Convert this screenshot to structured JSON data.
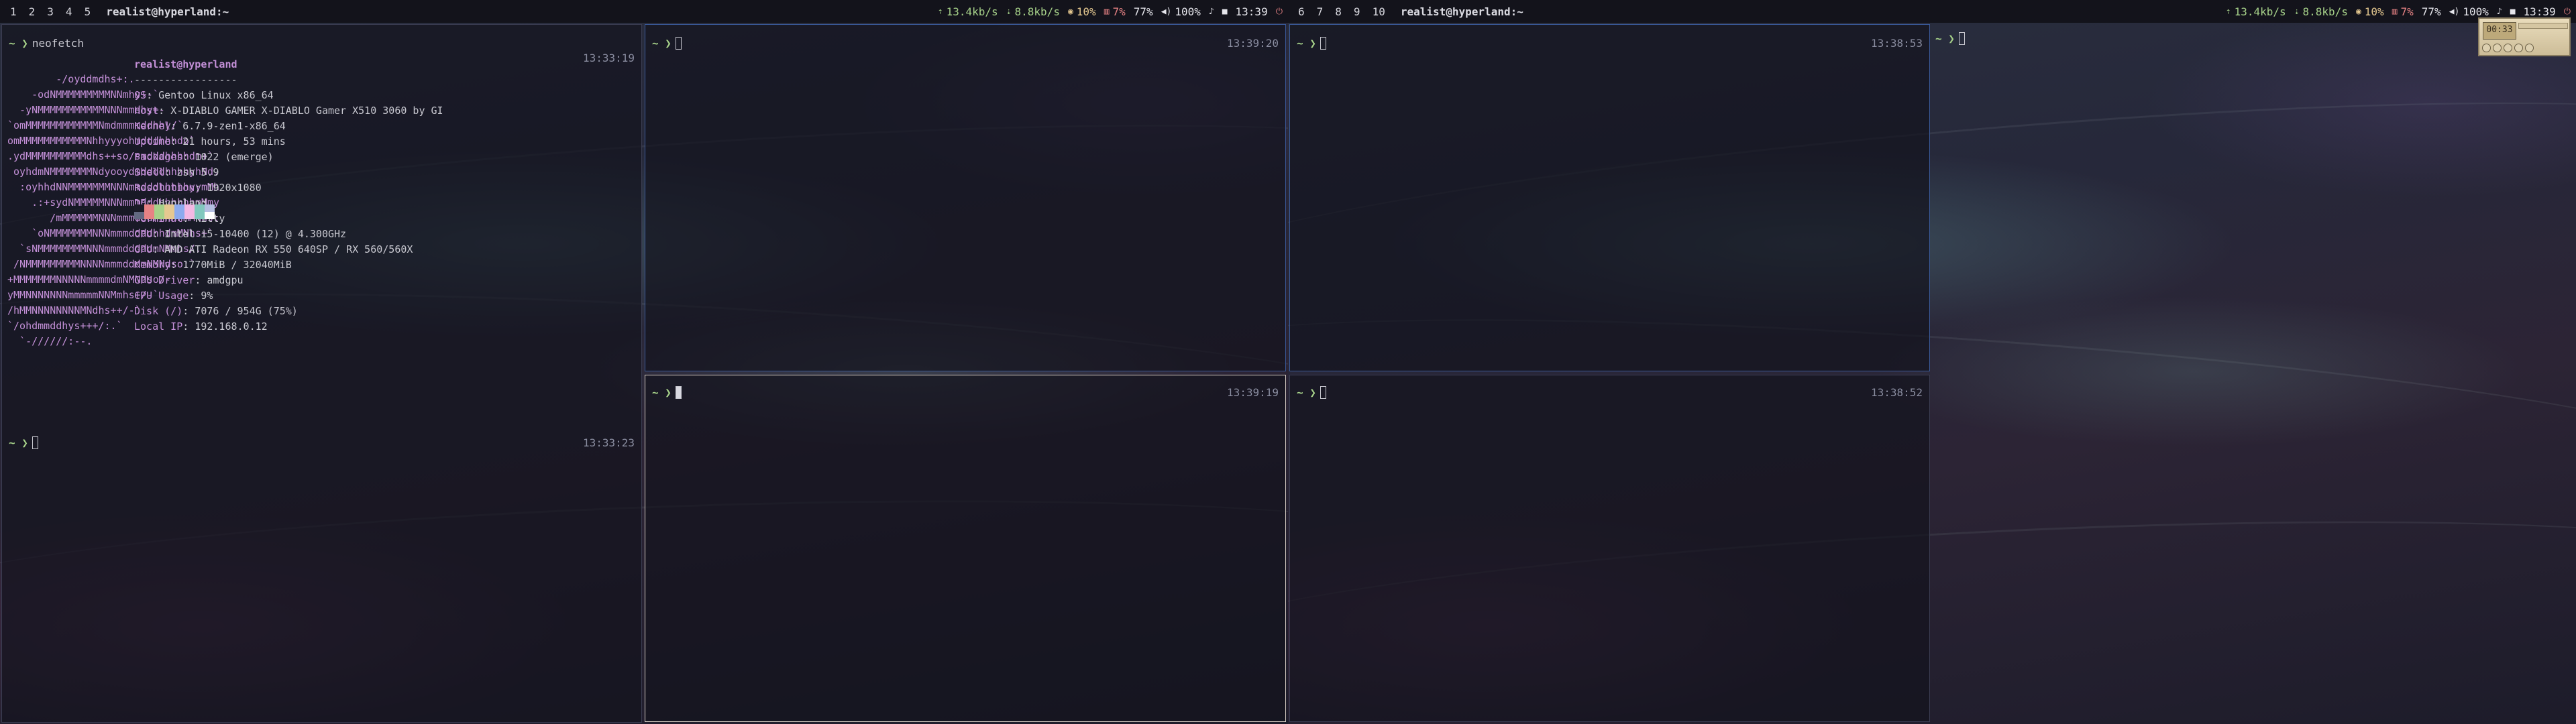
{
  "left_monitor": {
    "bar": {
      "workspaces": [
        "1",
        "2",
        "3",
        "4",
        "5"
      ],
      "title": "realist@hyperland:~",
      "net_up": "13.4kb/s",
      "net_down": "8.8kb/s",
      "cpu": "10%",
      "mem": "7%",
      "brightness": "77%",
      "volume": "100%",
      "clock": "13:39"
    },
    "neofetch_pane": {
      "command": "neofetch",
      "time_top": "13:33:19",
      "time_bottom": "13:33:23",
      "logo_lines": [
        "        -/oyddmdhs+:.",
        "    -odNMMMMMMMMMNNmhy+-`",
        "  -yNMMMMMMMMMMMNNNmmdhy+-",
        "`omMMMMMMMMMMMMNmdmmmmddhhy/`",
        "omMMMMMMMMMMMNhhyyyohmdddhhhdo`",
        ".ydMMMMMMMMMMdhs++so/smdddhhhhdm+`",
        " oyhdmNMMMMMMMNdyooydmddddhhhhyhNd.",
        "  :oyhhdNNMMMMMMMNNNmmdddhhhhhyymMh",
        "    .:+sydNMMMMMNNNmmmdddhhhhhhmMmy",
        "       /mMMMMMMNNNmmmdddhhhhhmMNhs:",
        "    `oNMMMMMMMNNNmmmddddhhdmMNhs+`",
        "  `sNMMMMMMMMNNNmmmdddddmNMmhs/.",
        " /NMMMMMMMMMNNNNmmmdddmNMNdso:`",
        "+MMMMMMMNNNNNmmmmdmNMNdso/-",
        "yMMNNNNNNNmmmmmNNMmhs+/-`",
        "/hMMNNNNNNNNMNdhs++/-`",
        "`/ohdmmddhys+++/:.`",
        "  `-//////:--."
      ],
      "user_host": "realist@hyperland",
      "separator": "-----------------",
      "info": [
        {
          "k": "OS",
          "v": "Gentoo Linux x86_64"
        },
        {
          "k": "Host",
          "v": "X-DIABLO GAMER X-DIABLO Gamer X510 3060 by GI"
        },
        {
          "k": "Kernel",
          "v": "6.7.9-zen1-x86_64"
        },
        {
          "k": "Uptime",
          "v": "21 hours, 53 mins"
        },
        {
          "k": "Packages",
          "v": "1022 (emerge)"
        },
        {
          "k": "Shell",
          "v": "zsh 5.9"
        },
        {
          "k": "Resolution",
          "v": "1920x1080"
        },
        {
          "k": "DE",
          "v": "Hyprland"
        },
        {
          "k": "Terminal",
          "v": "kitty"
        },
        {
          "k": "CPU",
          "v": "Intel i5-10400 (12) @ 4.300GHz"
        },
        {
          "k": "GPU",
          "v": "AMD ATI Radeon RX 550 640SP / RX 560/560X"
        },
        {
          "k": "Memory",
          "v": "1770MiB / 32040MiB"
        },
        {
          "k": "GPU Driver",
          "v": "amdgpu"
        },
        {
          "k": "CPU Usage",
          "v": "9%"
        },
        {
          "k": "Disk (/)",
          "v": "7076 / 954G (75%)"
        },
        {
          "k": "Local IP",
          "v": "192.168.0.12"
        }
      ],
      "palette_top": [
        "#1b1b27",
        "#e78284",
        "#a6d189",
        "#e5c890",
        "#8caaee",
        "#f4b8e4",
        "#81c8be",
        "#b5bfe2"
      ],
      "palette_bottom": [
        "#626880",
        "#e78284",
        "#a6d189",
        "#e5c890",
        "#8caaee",
        "#f4b8e4",
        "#81c8be",
        "#ffffff"
      ]
    },
    "pane_top_right": {
      "time": "13:39:20"
    },
    "pane_bottom_right": {
      "time": "13:39:19"
    }
  },
  "right_monitor": {
    "bar": {
      "workspaces": [
        "6",
        "7",
        "8",
        "9",
        "10"
      ],
      "title": "realist@hyperland:~",
      "net_up": "13.4kb/s",
      "net_down": "8.8kb/s",
      "cpu": "10%",
      "mem": "7%",
      "brightness": "77%",
      "volume": "100%",
      "clock": "13:39"
    },
    "pane_top_left": {
      "time": "13:38:53"
    },
    "pane_bottom_left": {
      "time": "13:38:52"
    },
    "winamp": {
      "display": "00:33"
    }
  },
  "prompt_symbol": "~ ❯",
  "icons": {
    "net_up": "upload-icon",
    "net_down": "download-icon",
    "cpu": "cpu-icon",
    "mem": "memory-icon",
    "volume": "volume-icon",
    "mic": "mic-icon",
    "lock": "lock-icon",
    "power": "power-icon"
  }
}
